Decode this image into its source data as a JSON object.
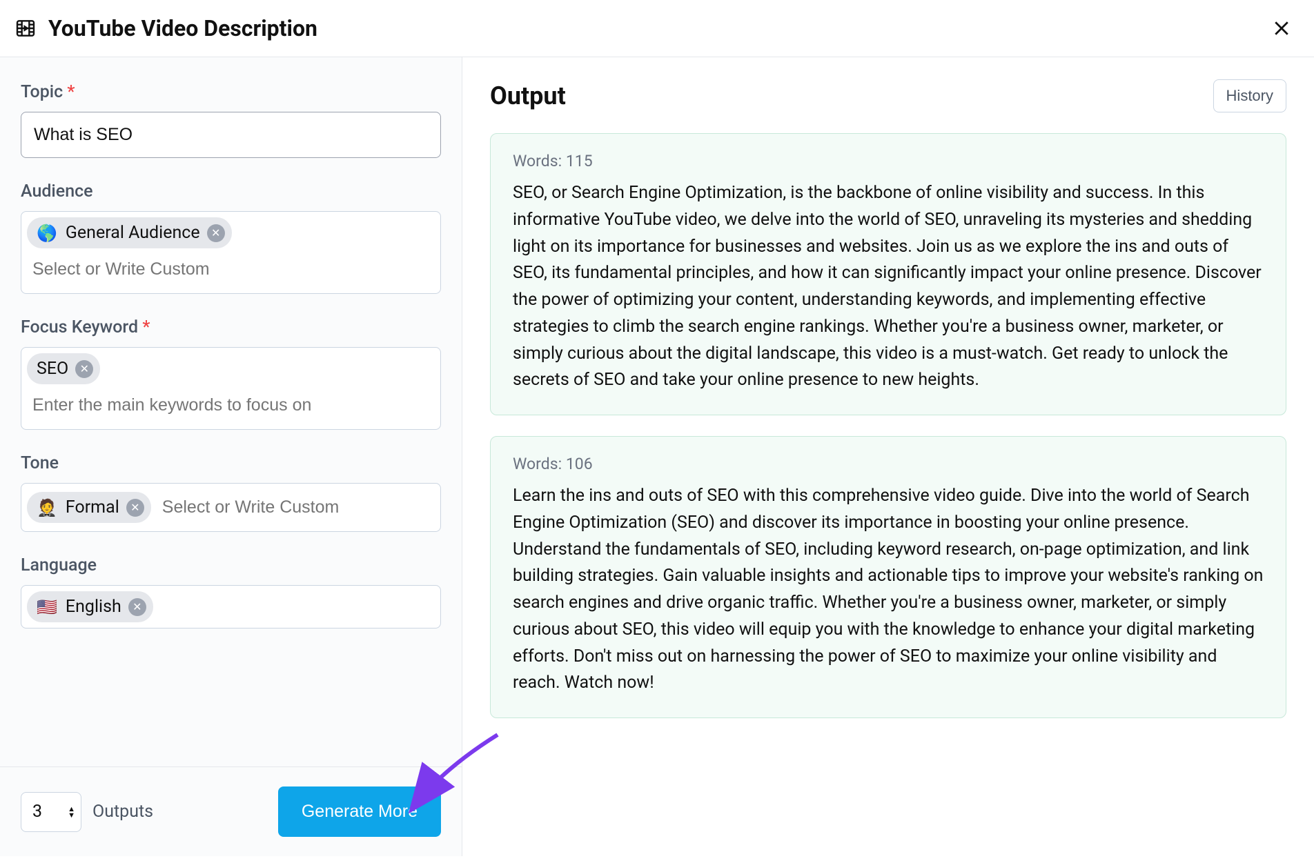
{
  "header": {
    "title": "YouTube Video Description"
  },
  "form": {
    "topic": {
      "label": "Topic",
      "value": "What is SEO"
    },
    "audience": {
      "label": "Audience",
      "tags": [
        {
          "emoji": "🌎",
          "text": "General Audience"
        }
      ],
      "placeholder": "Select or Write Custom"
    },
    "focus_keyword": {
      "label": "Focus Keyword",
      "tags": [
        {
          "emoji": "",
          "text": "SEO"
        }
      ],
      "placeholder": "Enter the main keywords to focus on"
    },
    "tone": {
      "label": "Tone",
      "tags": [
        {
          "emoji": "🤵",
          "text": "Formal"
        }
      ],
      "placeholder": "Select or Write Custom"
    },
    "language": {
      "label": "Language",
      "tags": [
        {
          "emoji": "🇺🇸",
          "text": "English"
        }
      ]
    }
  },
  "bottom": {
    "outputs_count": "3",
    "outputs_label": "Outputs",
    "generate_label": "Generate More"
  },
  "right": {
    "title": "Output",
    "history_label": "History",
    "cards": [
      {
        "words_label": "Words: 115",
        "text": "SEO, or Search Engine Optimization, is the backbone of online visibility and success. In this informative YouTube video, we delve into the world of SEO, unraveling its mysteries and shedding light on its importance for businesses and websites. Join us as we explore the ins and outs of SEO, its fundamental principles, and how it can significantly impact your online presence. Discover the power of optimizing your content, understanding keywords, and implementing effective strategies to climb the search engine rankings. Whether you're a business owner, marketer, or simply curious about the digital landscape, this video is a must-watch. Get ready to unlock the secrets of SEO and take your online presence to new heights."
      },
      {
        "words_label": "Words: 106",
        "text": "Learn the ins and outs of SEO with this comprehensive video guide. Dive into the world of Search Engine Optimization (SEO) and discover its importance in boosting your online presence. Understand the fundamentals of SEO, including keyword research, on-page optimization, and link building strategies. Gain valuable insights and actionable tips to improve your website's ranking on search engines and drive organic traffic. Whether you're a business owner, marketer, or simply curious about SEO, this video will equip you with the knowledge to enhance your digital marketing efforts. Don't miss out on harnessing the power of SEO to maximize your online visibility and reach. Watch now!"
      }
    ]
  }
}
